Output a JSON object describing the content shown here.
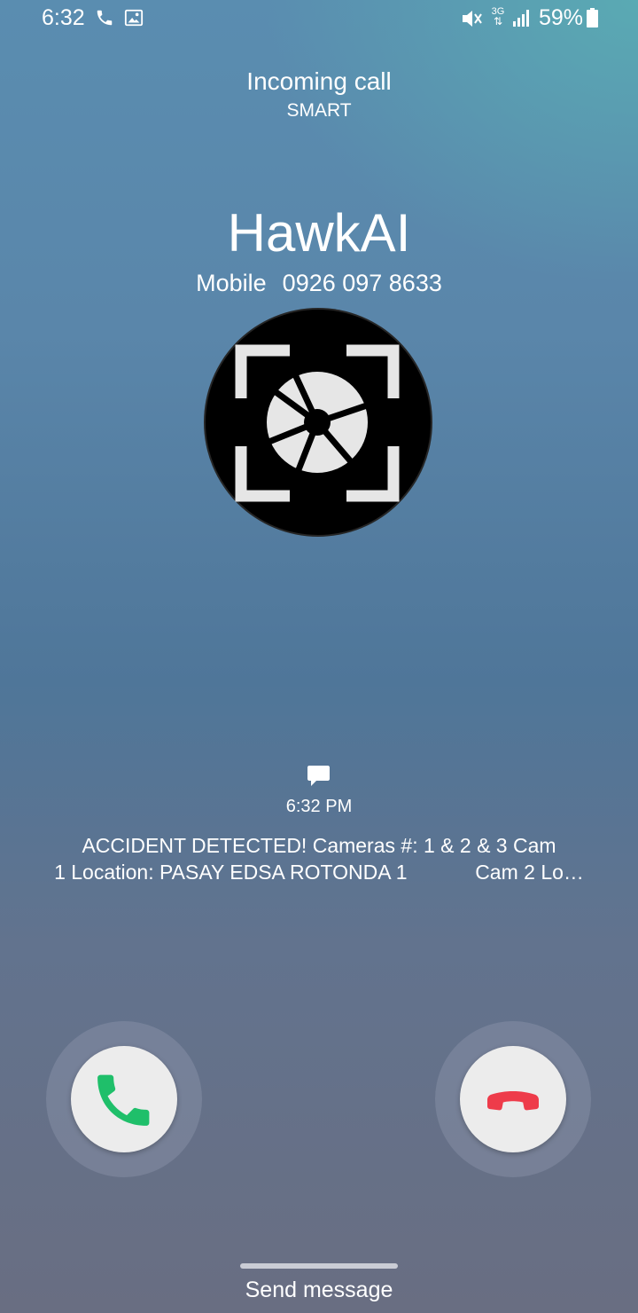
{
  "status_bar": {
    "time": "6:32",
    "network": "3G",
    "battery": "59%",
    "icons": [
      "phone-icon",
      "image-icon",
      "mute-icon",
      "network-3g-icon",
      "signal-icon",
      "battery-icon"
    ]
  },
  "call": {
    "label": "Incoming call",
    "carrier": "SMART",
    "caller_name": "HawkAI",
    "number_type": "Mobile",
    "number": "0926 097 8633"
  },
  "message": {
    "time": "6:32 PM",
    "line1": "ACCIDENT DETECTED! Cameras #: 1 & 2 & 3 Cam",
    "line2": "1 Location: PASAY EDSA ROTONDA 1            Cam 2 Lo…"
  },
  "actions": {
    "send_message": "Send message"
  },
  "colors": {
    "accept": "#1fbf6a",
    "decline": "#ee3b4a"
  }
}
